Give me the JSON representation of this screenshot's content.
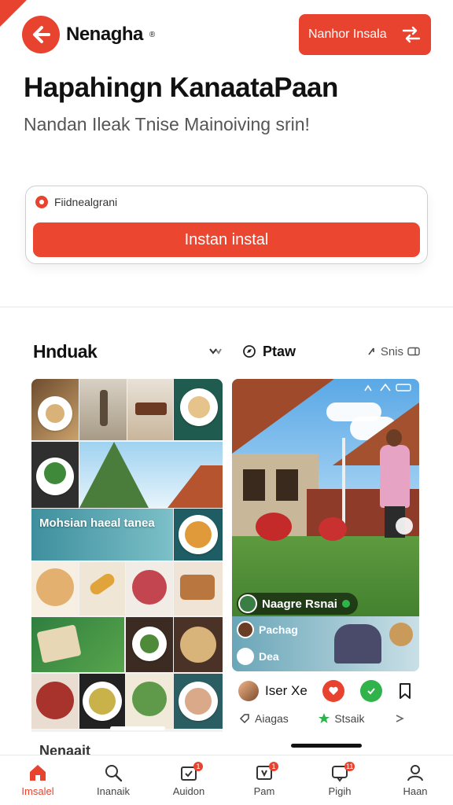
{
  "brand": {
    "name": "Nenagha",
    "trademark": "®"
  },
  "header": {
    "cta_label": "Nanhor Insala"
  },
  "hero": {
    "title": "Hapahingn KanaataPaan",
    "subtitle": "Nandan Ileak Tnise Mainoiving srin!"
  },
  "install": {
    "note": "Fiidnealgrani",
    "button_label": "Instan instal"
  },
  "left_section": {
    "title": "Hnduak"
  },
  "right_section": {
    "title": "Ptaw",
    "sort_label": "Snis"
  },
  "grid_card": {
    "banner_text": "Mohsian haeal tanea",
    "caption": "Nenaait"
  },
  "photo_card": {
    "caption": "Naagre Rsnai",
    "sub_title": "Pachag",
    "sub_label": "Dea"
  },
  "post_actions": {
    "user_name": "Iser Xe",
    "meta_left": "Aiagas",
    "meta_right": "Stsaik"
  },
  "tabbar": {
    "items": [
      {
        "label": "Imsalel",
        "icon": "home-icon",
        "active": true
      },
      {
        "label": "Inanaik",
        "icon": "search-icon",
        "active": false
      },
      {
        "label": "Auidon",
        "icon": "calendar-icon",
        "active": false,
        "badge": "1"
      },
      {
        "label": "Pam",
        "icon": "video-icon",
        "active": false,
        "badge": "1"
      },
      {
        "label": "Pigih",
        "icon": "chat-icon",
        "active": false,
        "badge": "11"
      },
      {
        "label": "Haan",
        "icon": "profile-icon",
        "active": false
      }
    ]
  },
  "colors": {
    "accent": "#e8432f",
    "text": "#111111",
    "muted": "#555555",
    "green": "#2fb34a"
  }
}
